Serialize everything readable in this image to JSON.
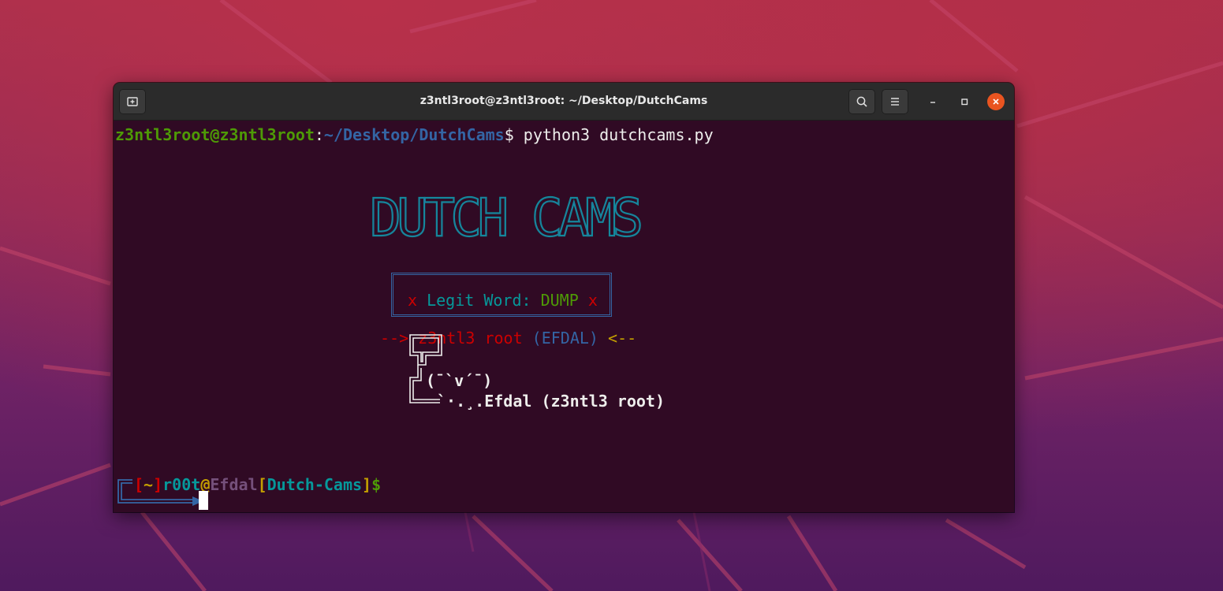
{
  "window": {
    "title": "z3ntl3root@z3ntl3root: ~/Desktop/DutchCams"
  },
  "icons": {
    "new_tab": "new-tab-icon",
    "search": "search-icon",
    "menu": "hamburger-menu-icon",
    "minimize": "minimize-icon",
    "maximize": "maximize-icon",
    "close": "close-icon"
  },
  "colors": {
    "terminal_bg": "#300a24",
    "green": "#4e9a06",
    "blue": "#3465a4",
    "cyan": "#06989a",
    "red": "#cc0000",
    "yellow": "#c4a000",
    "magenta": "#75507b",
    "accent_orange": "#e95420"
  },
  "terminal": {
    "prompt": {
      "user_host": "z3ntl3root@z3ntl3root",
      "sep": ":",
      "path": "~/Desktop/DutchCams",
      "dollar": "$ ",
      "command": "python3 dutchcams.py"
    },
    "banner": {
      "logo_text": "DUTCH CAMS",
      "arrow_left": "-->",
      "author_name": "z3ntl3 root",
      "author_alias": "(EFDAL)",
      "arrow_right": "<--",
      "box_left_x": "x",
      "box_label": "Legit Word:",
      "box_word": "DUMP",
      "box_right_x": "x",
      "sign_face": "(¯`v´¯)",
      "sign_line": "`·.¸.Efdal (z3ntl3 root)"
    },
    "shell_prompt": {
      "lbracket": "[",
      "tilde": "~",
      "rbracket": "]",
      "user": "r00t",
      "at": "@",
      "host": "Efdal",
      "lbracket2": "[",
      "project": "Dutch-Cams",
      "rbracket2": "]",
      "dollar": "$"
    }
  }
}
